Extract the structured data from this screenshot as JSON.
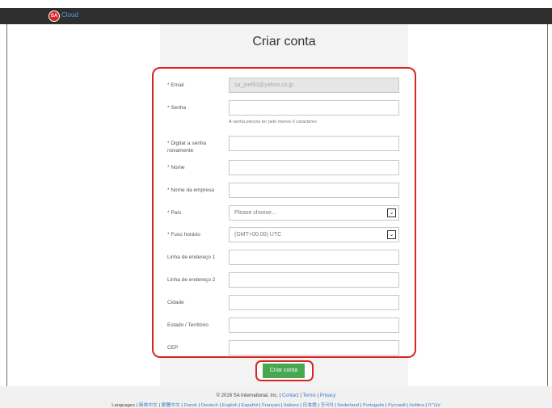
{
  "header": {
    "logo_badge": "SA",
    "logo_word": "Cloud"
  },
  "page": {
    "title": "Criar conta"
  },
  "form": {
    "email": {
      "label": "* Email",
      "value": "sa_joel93@yahoo.co.jp"
    },
    "password": {
      "label": "* Senha",
      "value": "",
      "hint": "A senha precisa ter pelo menos 6 caracteres"
    },
    "password_confirm": {
      "label": "* Digitar a senha novamente",
      "value": ""
    },
    "name": {
      "label": "* Nome",
      "value": ""
    },
    "company": {
      "label": "* Nome da empresa",
      "value": ""
    },
    "country": {
      "label": "* País",
      "value": "Please choose..."
    },
    "timezone": {
      "label": "* Fuso horário",
      "value": "(GMT+00:00) UTC"
    },
    "address1": {
      "label": "Linha de endereço 1",
      "value": ""
    },
    "address2": {
      "label": "Linha de endereço 2",
      "value": ""
    },
    "city": {
      "label": "Cidade",
      "value": ""
    },
    "state": {
      "label": "Estado / Território",
      "value": ""
    },
    "zip": {
      "label": "CEP",
      "value": ""
    },
    "submit_label": "Criar conta"
  },
  "footer": {
    "copyright": "© 2016 SA International, Inc. |",
    "contact": "Contact",
    "terms": "Terms",
    "privacy": "Privacy",
    "sep": "|",
    "languages_label": "Languages |",
    "languages": [
      "简体中文",
      "繁體中文",
      "Dansk",
      "Deutsch",
      "English",
      "Español",
      "Français",
      "Italiano",
      "日本語",
      "한국어",
      "Nederland",
      "Português",
      "Русский",
      "čeština",
      "עברית"
    ]
  },
  "colors": {
    "accent_red": "#d7261e",
    "button_green": "#48a852",
    "link_blue": "#3b78c4"
  }
}
